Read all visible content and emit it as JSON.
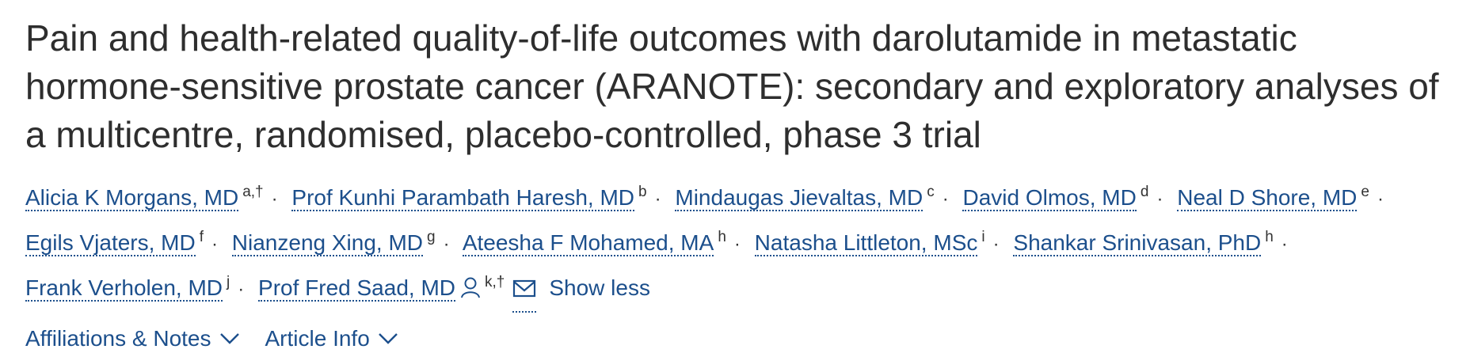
{
  "title": "Pain and health-related quality-of-life outcomes with darolutamide in metastatic hormone-sensitive prostate cancer (ARANOTE): secondary and exploratory analyses of a multicentre, randomised, placebo-controlled, phase 3 trial",
  "authors": [
    {
      "name": "Alicia K Morgans, MD",
      "sup": "a,†"
    },
    {
      "name": "Prof Kunhi Parambath Haresh, MD",
      "sup": "b"
    },
    {
      "name": "Mindaugas Jievaltas, MD",
      "sup": "c"
    },
    {
      "name": "David Olmos, MD",
      "sup": "d"
    },
    {
      "name": "Neal D Shore, MD",
      "sup": "e"
    },
    {
      "name": "Egils Vjaters, MD",
      "sup": "f"
    },
    {
      "name": "Nianzeng Xing, MD",
      "sup": "g"
    },
    {
      "name": "Ateesha F Mohamed, MA",
      "sup": "h"
    },
    {
      "name": "Natasha Littleton, MSc",
      "sup": "i"
    },
    {
      "name": "Shankar Srinivasan, PhD",
      "sup": "h"
    },
    {
      "name": "Frank Verholen, MD",
      "sup": "j"
    },
    {
      "name": "Prof Fred Saad, MD",
      "sup": "k,†"
    }
  ],
  "separator": "·",
  "show_less_label": "Show less",
  "toggles": {
    "affiliations_label": "Affiliations & Notes",
    "article_info_label": "Article Info"
  },
  "icons": {
    "corresponding_author": "person-icon",
    "email": "mail-icon",
    "expand": "chevron-down-icon"
  },
  "colors": {
    "link": "#1c4f8c",
    "title": "#2e2e2e"
  }
}
